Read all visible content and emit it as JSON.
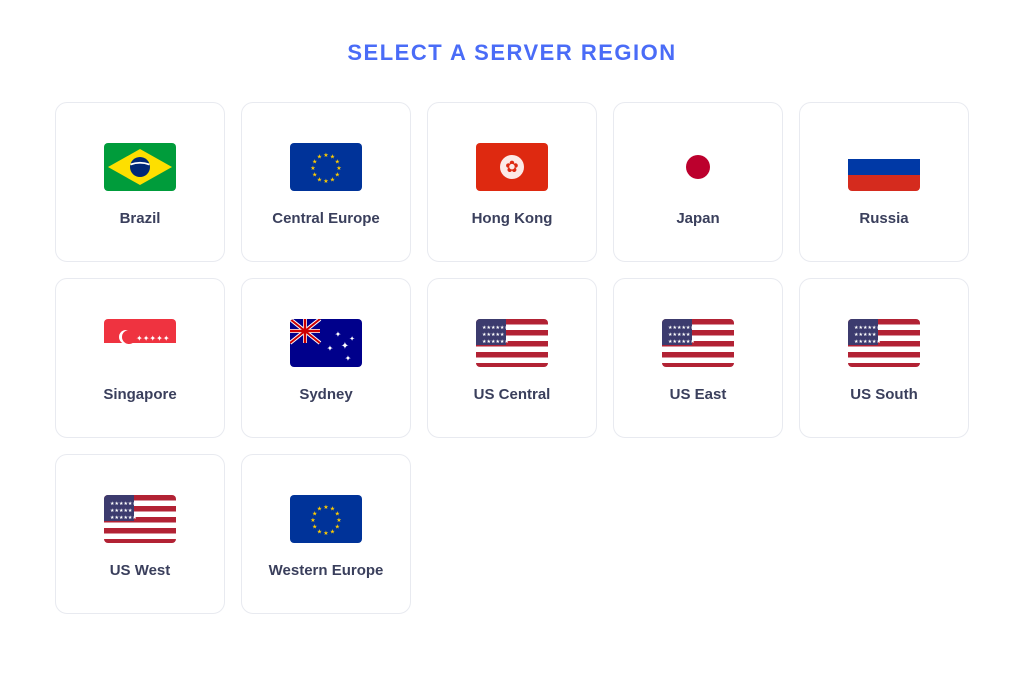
{
  "page": {
    "title": "SELECT A SERVER REGION"
  },
  "regions": [
    {
      "id": "brazil",
      "name": "Brazil",
      "flag": "brazil"
    },
    {
      "id": "central-europe",
      "name": "Central Europe",
      "flag": "eu"
    },
    {
      "id": "hong-kong",
      "name": "Hong Kong",
      "flag": "hk"
    },
    {
      "id": "japan",
      "name": "Japan",
      "flag": "japan"
    },
    {
      "id": "russia",
      "name": "Russia",
      "flag": "russia"
    },
    {
      "id": "singapore",
      "name": "Singapore",
      "flag": "singapore"
    },
    {
      "id": "sydney",
      "name": "Sydney",
      "flag": "australia"
    },
    {
      "id": "us-central",
      "name": "US Central",
      "flag": "us"
    },
    {
      "id": "us-east",
      "name": "US East",
      "flag": "us"
    },
    {
      "id": "us-south",
      "name": "US South",
      "flag": "us"
    },
    {
      "id": "us-west",
      "name": "US West",
      "flag": "us"
    },
    {
      "id": "western-europe",
      "name": "Western Europe",
      "flag": "eu"
    }
  ]
}
